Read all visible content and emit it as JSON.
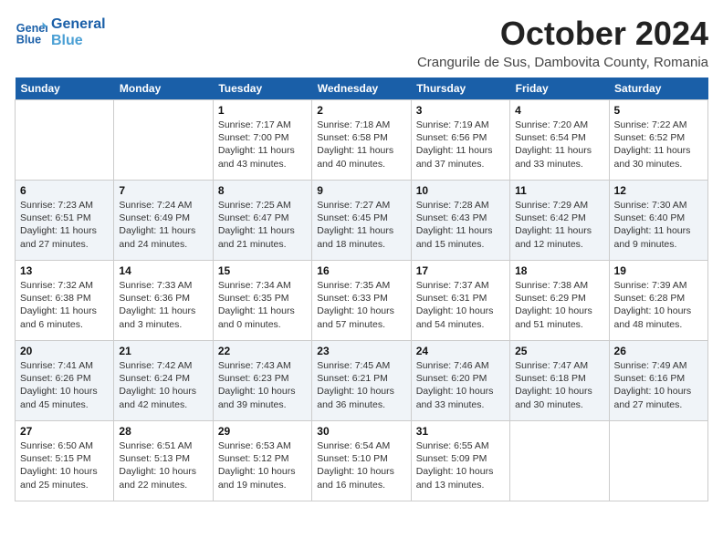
{
  "logo": {
    "line1": "General",
    "line2": "Blue"
  },
  "title": "October 2024",
  "location": "Crangurile de Sus, Dambovita County, Romania",
  "weekdays": [
    "Sunday",
    "Monday",
    "Tuesday",
    "Wednesday",
    "Thursday",
    "Friday",
    "Saturday"
  ],
  "weeks": [
    [
      {
        "day": "",
        "detail": ""
      },
      {
        "day": "",
        "detail": ""
      },
      {
        "day": "1",
        "detail": "Sunrise: 7:17 AM\nSunset: 7:00 PM\nDaylight: 11 hours\nand 43 minutes."
      },
      {
        "day": "2",
        "detail": "Sunrise: 7:18 AM\nSunset: 6:58 PM\nDaylight: 11 hours\nand 40 minutes."
      },
      {
        "day": "3",
        "detail": "Sunrise: 7:19 AM\nSunset: 6:56 PM\nDaylight: 11 hours\nand 37 minutes."
      },
      {
        "day": "4",
        "detail": "Sunrise: 7:20 AM\nSunset: 6:54 PM\nDaylight: 11 hours\nand 33 minutes."
      },
      {
        "day": "5",
        "detail": "Sunrise: 7:22 AM\nSunset: 6:52 PM\nDaylight: 11 hours\nand 30 minutes."
      }
    ],
    [
      {
        "day": "6",
        "detail": "Sunrise: 7:23 AM\nSunset: 6:51 PM\nDaylight: 11 hours\nand 27 minutes."
      },
      {
        "day": "7",
        "detail": "Sunrise: 7:24 AM\nSunset: 6:49 PM\nDaylight: 11 hours\nand 24 minutes."
      },
      {
        "day": "8",
        "detail": "Sunrise: 7:25 AM\nSunset: 6:47 PM\nDaylight: 11 hours\nand 21 minutes."
      },
      {
        "day": "9",
        "detail": "Sunrise: 7:27 AM\nSunset: 6:45 PM\nDaylight: 11 hours\nand 18 minutes."
      },
      {
        "day": "10",
        "detail": "Sunrise: 7:28 AM\nSunset: 6:43 PM\nDaylight: 11 hours\nand 15 minutes."
      },
      {
        "day": "11",
        "detail": "Sunrise: 7:29 AM\nSunset: 6:42 PM\nDaylight: 11 hours\nand 12 minutes."
      },
      {
        "day": "12",
        "detail": "Sunrise: 7:30 AM\nSunset: 6:40 PM\nDaylight: 11 hours\nand 9 minutes."
      }
    ],
    [
      {
        "day": "13",
        "detail": "Sunrise: 7:32 AM\nSunset: 6:38 PM\nDaylight: 11 hours\nand 6 minutes."
      },
      {
        "day": "14",
        "detail": "Sunrise: 7:33 AM\nSunset: 6:36 PM\nDaylight: 11 hours\nand 3 minutes."
      },
      {
        "day": "15",
        "detail": "Sunrise: 7:34 AM\nSunset: 6:35 PM\nDaylight: 11 hours\nand 0 minutes."
      },
      {
        "day": "16",
        "detail": "Sunrise: 7:35 AM\nSunset: 6:33 PM\nDaylight: 10 hours\nand 57 minutes."
      },
      {
        "day": "17",
        "detail": "Sunrise: 7:37 AM\nSunset: 6:31 PM\nDaylight: 10 hours\nand 54 minutes."
      },
      {
        "day": "18",
        "detail": "Sunrise: 7:38 AM\nSunset: 6:29 PM\nDaylight: 10 hours\nand 51 minutes."
      },
      {
        "day": "19",
        "detail": "Sunrise: 7:39 AM\nSunset: 6:28 PM\nDaylight: 10 hours\nand 48 minutes."
      }
    ],
    [
      {
        "day": "20",
        "detail": "Sunrise: 7:41 AM\nSunset: 6:26 PM\nDaylight: 10 hours\nand 45 minutes."
      },
      {
        "day": "21",
        "detail": "Sunrise: 7:42 AM\nSunset: 6:24 PM\nDaylight: 10 hours\nand 42 minutes."
      },
      {
        "day": "22",
        "detail": "Sunrise: 7:43 AM\nSunset: 6:23 PM\nDaylight: 10 hours\nand 39 minutes."
      },
      {
        "day": "23",
        "detail": "Sunrise: 7:45 AM\nSunset: 6:21 PM\nDaylight: 10 hours\nand 36 minutes."
      },
      {
        "day": "24",
        "detail": "Sunrise: 7:46 AM\nSunset: 6:20 PM\nDaylight: 10 hours\nand 33 minutes."
      },
      {
        "day": "25",
        "detail": "Sunrise: 7:47 AM\nSunset: 6:18 PM\nDaylight: 10 hours\nand 30 minutes."
      },
      {
        "day": "26",
        "detail": "Sunrise: 7:49 AM\nSunset: 6:16 PM\nDaylight: 10 hours\nand 27 minutes."
      }
    ],
    [
      {
        "day": "27",
        "detail": "Sunrise: 6:50 AM\nSunset: 5:15 PM\nDaylight: 10 hours\nand 25 minutes."
      },
      {
        "day": "28",
        "detail": "Sunrise: 6:51 AM\nSunset: 5:13 PM\nDaylight: 10 hours\nand 22 minutes."
      },
      {
        "day": "29",
        "detail": "Sunrise: 6:53 AM\nSunset: 5:12 PM\nDaylight: 10 hours\nand 19 minutes."
      },
      {
        "day": "30",
        "detail": "Sunrise: 6:54 AM\nSunset: 5:10 PM\nDaylight: 10 hours\nand 16 minutes."
      },
      {
        "day": "31",
        "detail": "Sunrise: 6:55 AM\nSunset: 5:09 PM\nDaylight: 10 hours\nand 13 minutes."
      },
      {
        "day": "",
        "detail": ""
      },
      {
        "day": "",
        "detail": ""
      }
    ]
  ]
}
